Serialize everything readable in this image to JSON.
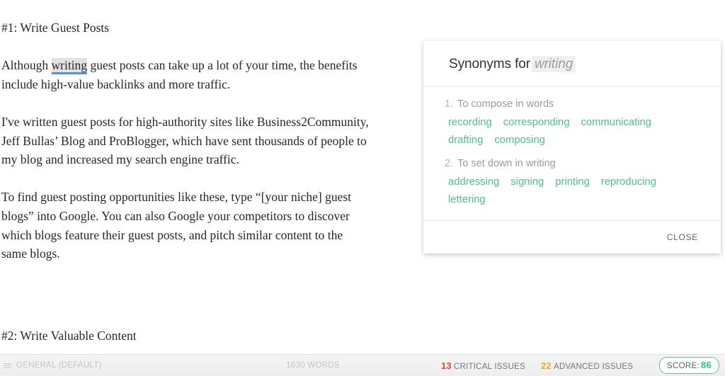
{
  "editor": {
    "heading_1": "#1: Write Guest Posts",
    "paragraph_1_before": "Although ",
    "highlighted_word": "writing",
    "paragraph_1_after": " guest posts can take up a lot of your time, the benefits include high-value backlinks and more traffic.",
    "paragraph_2": "I've written guest posts for high-authority sites like Business2Community, Jeff Bullas’ Blog and ProBlogger, which have sent thousands of people to my blog and increased my search engine traffic.",
    "paragraph_3": "To find guest posting opportunities like these, type “[your niche] guest blogs” into Google. You can also Google your competitors to discover which blogs feature their guest posts, and pitch similar content to the same blogs.",
    "heading_2": "#2: Write Valuable Content"
  },
  "synonyms_panel": {
    "title_prefix": "Synonyms for",
    "target_word": "writing",
    "senses": [
      {
        "number": "1.",
        "definition": "To compose in words",
        "words": [
          "recording",
          "corresponding",
          "communicating",
          "drafting",
          "composing"
        ]
      },
      {
        "number": "2.",
        "definition": "To set down in writing",
        "words": [
          "addressing",
          "signing",
          "printing",
          "reproducing",
          "lettering"
        ]
      }
    ],
    "close_label": "CLOSE"
  },
  "status_bar": {
    "menu_icon": "hamburger-icon",
    "style_label": "GENERAL (DEFAULT)",
    "word_count": "1630 WORDS",
    "critical_count": "13",
    "critical_label": "CRITICAL ISSUES",
    "advanced_count": "22",
    "advanced_label": "ADVANCED ISSUES",
    "score_label": "SCORE:",
    "score_value": "86"
  },
  "colors": {
    "synonym_green": "#51bd8b",
    "critical_red": "#e8413c",
    "advanced_orange": "#eeac1c",
    "score_green": "#3cb878",
    "highlight_underline_blue": "#5b8fd0",
    "highlight_background": "#e2e2e2"
  }
}
